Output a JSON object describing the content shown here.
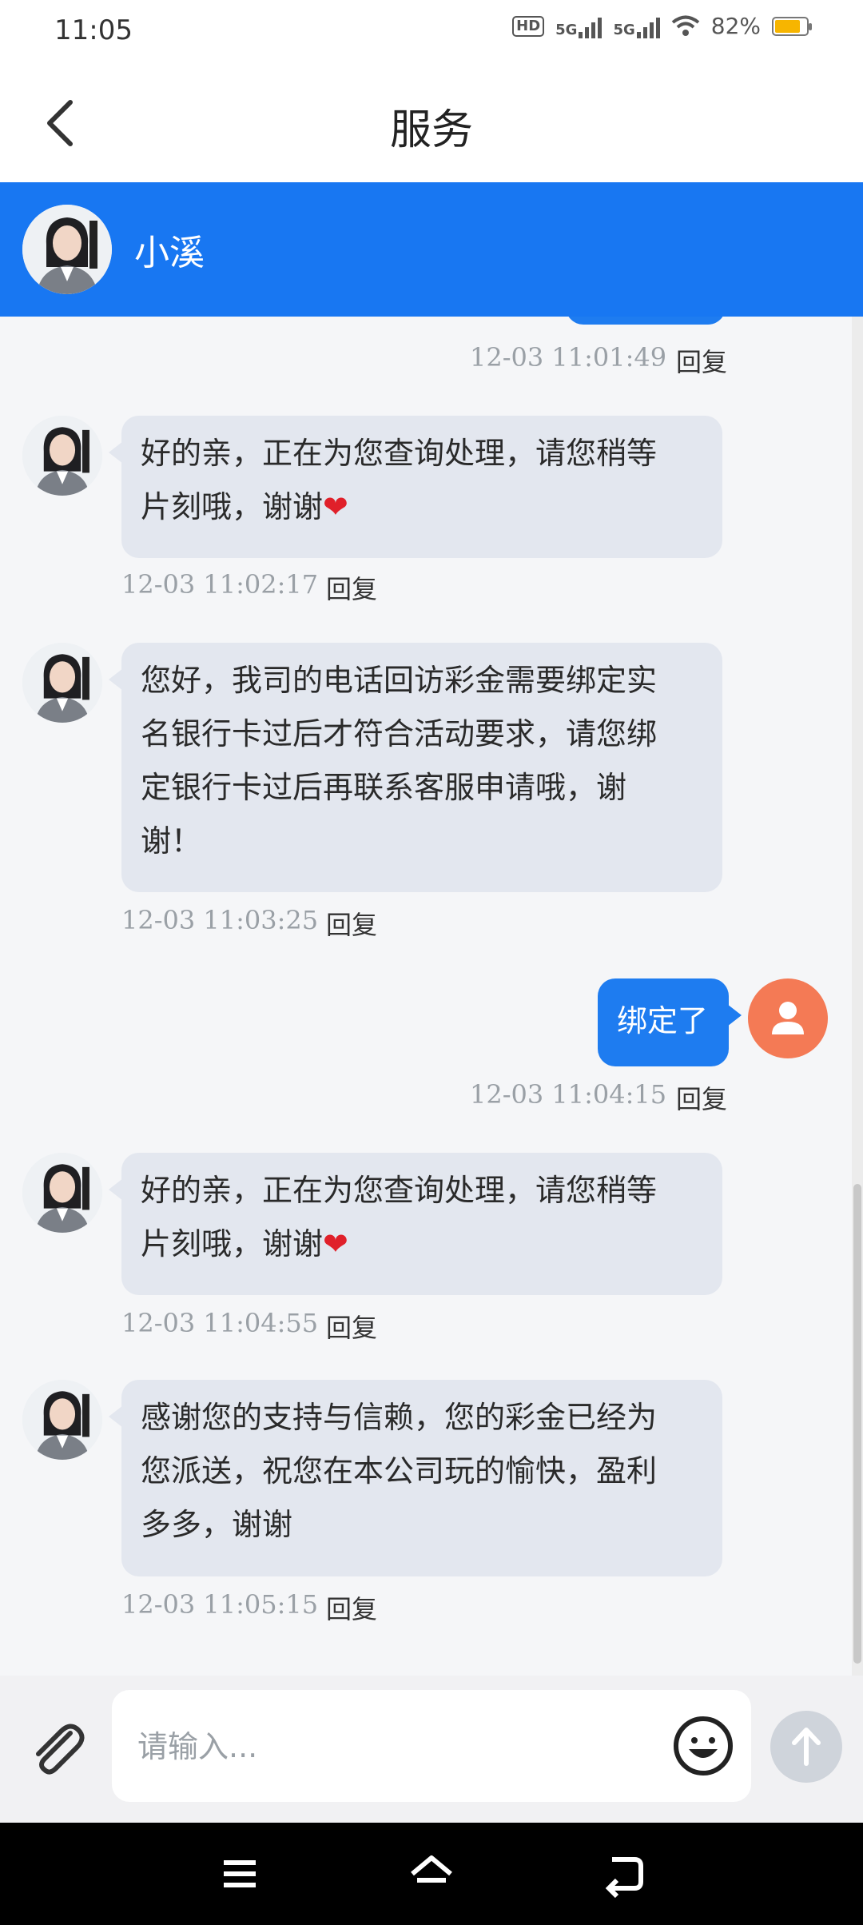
{
  "status": {
    "time": "11:05",
    "battery": "82%",
    "hd": "HD",
    "net1": "5G",
    "net2": "5G"
  },
  "title": "服务",
  "agent": {
    "name": "小溪"
  },
  "messages": [
    {
      "from": "me",
      "time": "12-03 11:01:49",
      "reply": "回复"
    },
    {
      "from": "agent",
      "lines": [
        "好的亲，正在为您查询处理，请您稍等",
        "片刻哦，谢谢"
      ],
      "heart": "❤",
      "time": "12-03 11:02:17",
      "reply": "回复"
    },
    {
      "from": "agent",
      "lines": [
        "您好，我司的电话回访彩金需要绑定实",
        "名银行卡过后才符合活动要求，请您绑",
        "定银行卡过后再联系客服申请哦，谢",
        "谢！"
      ],
      "time": "12-03 11:03:25",
      "reply": "回复"
    },
    {
      "from": "me",
      "text": "绑定了",
      "time": "12-03 11:04:15",
      "reply": "回复"
    },
    {
      "from": "agent",
      "lines": [
        "好的亲，正在为您查询处理，请您稍等",
        "片刻哦，谢谢"
      ],
      "heart": "❤",
      "time": "12-03 11:04:55",
      "reply": "回复"
    },
    {
      "from": "agent",
      "lines": [
        "感谢您的支持与信赖，您的彩金已经为",
        "您派送，祝您在本公司玩的愉快，盈利",
        "多多，谢谢"
      ],
      "time": "12-03 11:05:15",
      "reply": "回复"
    }
  ],
  "input": {
    "placeholder": "请输入..."
  },
  "colors": {
    "primary": "#1877f2",
    "user_avatar": "#f47a55",
    "agent_bubble": "#e3e7ef"
  }
}
